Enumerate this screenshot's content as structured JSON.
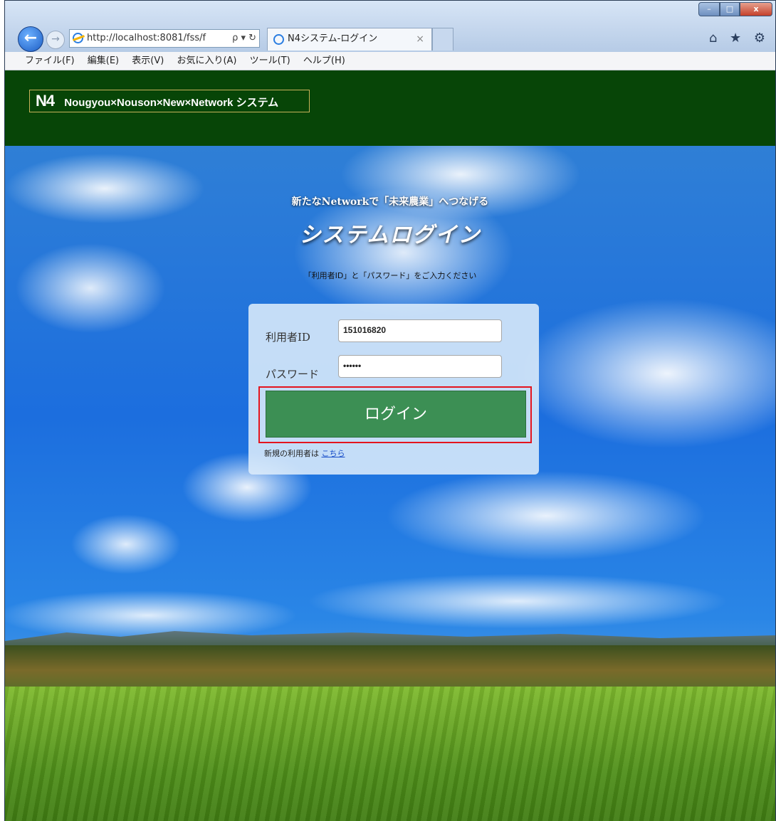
{
  "browser": {
    "address": "http://localhost:8081/fss/f",
    "address_controls": "ρ ▾ ↻",
    "tab_title": "N4システム-ログイン",
    "tab_close": "×",
    "window_controls": {
      "minimize": "–",
      "maximize": "□",
      "close": "x"
    },
    "toolbar_icons": "⌂ ★ ⚙"
  },
  "menu": [
    "ファイル(F)",
    "編集(E)",
    "表示(V)",
    "お気に入り(A)",
    "ツール(T)",
    "ヘルプ(H)"
  ],
  "header": {
    "logo_mark": "N4",
    "logo_text": "Nougyou×Nouson×New×Network システム"
  },
  "login": {
    "tagline": "新たなNetworkで「未来農業」へつなげる",
    "title": "システムログイン",
    "instruction": "「利用者ID」と「パスワード」をご入力ください",
    "user_id_label": "利用者ID",
    "user_id_value": "151016820",
    "password_label": "パスワード",
    "password_value": "••••••",
    "login_button": "ログイン",
    "new_user_text": "新規の利用者は",
    "new_user_link": "こちら"
  },
  "colors": {
    "header_bg": "#074507",
    "button_bg": "#3c8f54",
    "highlight": "#e4141e"
  }
}
